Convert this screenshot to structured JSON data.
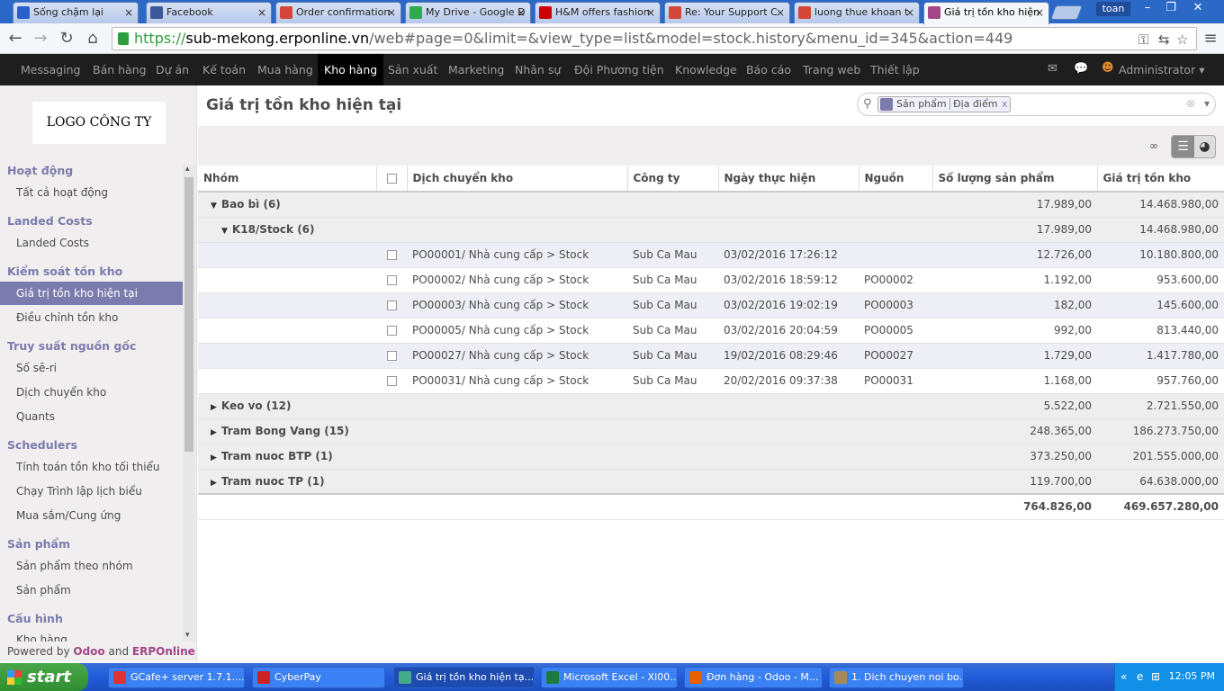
{
  "browser": {
    "tabs": [
      {
        "title": "Sống chậm lại",
        "color": "#2a5fcc"
      },
      {
        "title": "Facebook",
        "color": "#3b5998"
      },
      {
        "title": "Order confirmation",
        "color": "#d44638"
      },
      {
        "title": "My Drive - Google D",
        "color": "#2da94f"
      },
      {
        "title": "H&M offers fashion",
        "color": "#cc0000"
      },
      {
        "title": "Re: Your Support C",
        "color": "#d44638"
      },
      {
        "title": "luong thue khoan t",
        "color": "#d44638"
      },
      {
        "title": "Giá trị tồn kho hiện",
        "color": "#a24689"
      }
    ],
    "user": "toan",
    "url": {
      "scheme": "https://",
      "host": "sub-mekong.erponline.vn",
      "path": "/web#page=0&limit=&view_type=list&model=stock.history&menu_id=345&action=449"
    }
  },
  "topmenu": {
    "items": [
      "Messaging",
      "Bán hàng",
      "Dự án",
      "Kế toán",
      "Mua hàng",
      "Kho hàng",
      "Sản xuất",
      "Marketing",
      "Nhân sự",
      "Đội Phương tiện",
      "Knowledge",
      "Báo cáo",
      "Trang web",
      "Thiết lập"
    ],
    "active": "Kho hàng",
    "user": "Administrator"
  },
  "sidebar": {
    "logo": "LOGO CÔNG TY",
    "sections": [
      {
        "title": "Hoạt động",
        "items": [
          "Tất cả hoạt động"
        ]
      },
      {
        "title": "Landed Costs",
        "items": [
          "Landed Costs"
        ]
      },
      {
        "title": "Kiểm soát tồn kho",
        "items": [
          "Giá trị tồn kho hiện tại",
          "Điều chỉnh tồn kho"
        ]
      },
      {
        "title": "Truy suất nguồn gốc",
        "items": [
          "Số sê-ri",
          "Dịch chuyển kho",
          "Quants"
        ]
      },
      {
        "title": "Schedulers",
        "items": [
          "Tính toán tồn kho tối thiểu",
          "Chạy Trình lập lịch biểu",
          "Mua sắm/Cung ứng"
        ]
      },
      {
        "title": "Sản phẩm",
        "items": [
          "Sản phẩm theo nhóm",
          "Sản phẩm"
        ]
      },
      {
        "title": "Cấu hình",
        "items": [
          "Kho hàng"
        ]
      }
    ],
    "active_item": "Giá trị tồn kho hiện tại",
    "powered": {
      "prefix": "Powered by",
      "odoo": "Odoo",
      "and": "and",
      "erp": "ERPOnline"
    }
  },
  "page": {
    "title": "Giá trị tồn kho hiện tại",
    "search_facet": {
      "first": "Sản phẩm",
      "second": "Địa điểm",
      "remove": "x"
    },
    "infinity": "∞"
  },
  "table": {
    "headers": [
      "Nhóm",
      "",
      "Dịch chuyển kho",
      "Công ty",
      "Ngày thực hiện",
      "Nguồn",
      "Số lượng sản phẩm",
      "Giá trị tồn kho"
    ],
    "groups": [
      {
        "label": "Bao bì (6)",
        "qty": "17.989,00",
        "value": "14.468.980,00",
        "expanded": true
      },
      {
        "label": "K18/Stock (6)",
        "qty": "17.989,00",
        "value": "14.468.980,00",
        "expanded": true,
        "sub": true
      },
      {
        "label": "Keo vo (12)",
        "qty": "5.522,00",
        "value": "2.721.550,00"
      },
      {
        "label": "Tram Bong Vang (15)",
        "qty": "248.365,00",
        "value": "186.273.750,00"
      },
      {
        "label": "Tram nuoc BTP (1)",
        "qty": "373.250,00",
        "value": "201.555.000,00"
      },
      {
        "label": "Tram nuoc TP (1)",
        "qty": "119.700,00",
        "value": "64.638.000,00"
      }
    ],
    "rows": [
      {
        "move": "PO00001/ Nhà cung cấp > Stock",
        "company": "Sub Ca Mau",
        "date": "03/02/2016 17:26:12",
        "source": "",
        "qty": "12.726,00",
        "value": "10.180.800,00"
      },
      {
        "move": "PO00002/ Nhà cung cấp > Stock",
        "company": "Sub Ca Mau",
        "date": "03/02/2016 18:59:12",
        "source": "PO00002",
        "qty": "1.192,00",
        "value": "953.600,00"
      },
      {
        "move": "PO00003/ Nhà cung cấp > Stock",
        "company": "Sub Ca Mau",
        "date": "03/02/2016 19:02:19",
        "source": "PO00003",
        "qty": "182,00",
        "value": "145.600,00"
      },
      {
        "move": "PO00005/ Nhà cung cấp > Stock",
        "company": "Sub Ca Mau",
        "date": "03/02/2016 20:04:59",
        "source": "PO00005",
        "qty": "992,00",
        "value": "813.440,00"
      },
      {
        "move": "PO00027/ Nhà cung cấp > Stock",
        "company": "Sub Ca Mau",
        "date": "19/02/2016 08:29:46",
        "source": "PO00027",
        "qty": "1.729,00",
        "value": "1.417.780,00"
      },
      {
        "move": "PO00031/ Nhà cung cấp > Stock",
        "company": "Sub Ca Mau",
        "date": "20/02/2016 09:37:38",
        "source": "PO00031",
        "qty": "1.168,00",
        "value": "957.760,00"
      }
    ],
    "totals": {
      "qty": "764.826,00",
      "value": "469.657.280,00"
    }
  },
  "taskbar": {
    "start": "start",
    "items": [
      {
        "label": "GCafe+ server 1.7.1....",
        "color": "#d33"
      },
      {
        "label": "CyberPay",
        "color": "#c22"
      },
      {
        "label": "Giá trị tồn kho hiện tạ...",
        "color": "#4a8"
      },
      {
        "label": "Microsoft Excel - Xl00...",
        "color": "#1d7a3a"
      },
      {
        "label": "Đơn hàng - Odoo - M...",
        "color": "#e66000"
      },
      {
        "label": "1. Dich chuyen noi bo...",
        "color": "#a85"
      }
    ],
    "clock": "12:05 PM"
  }
}
